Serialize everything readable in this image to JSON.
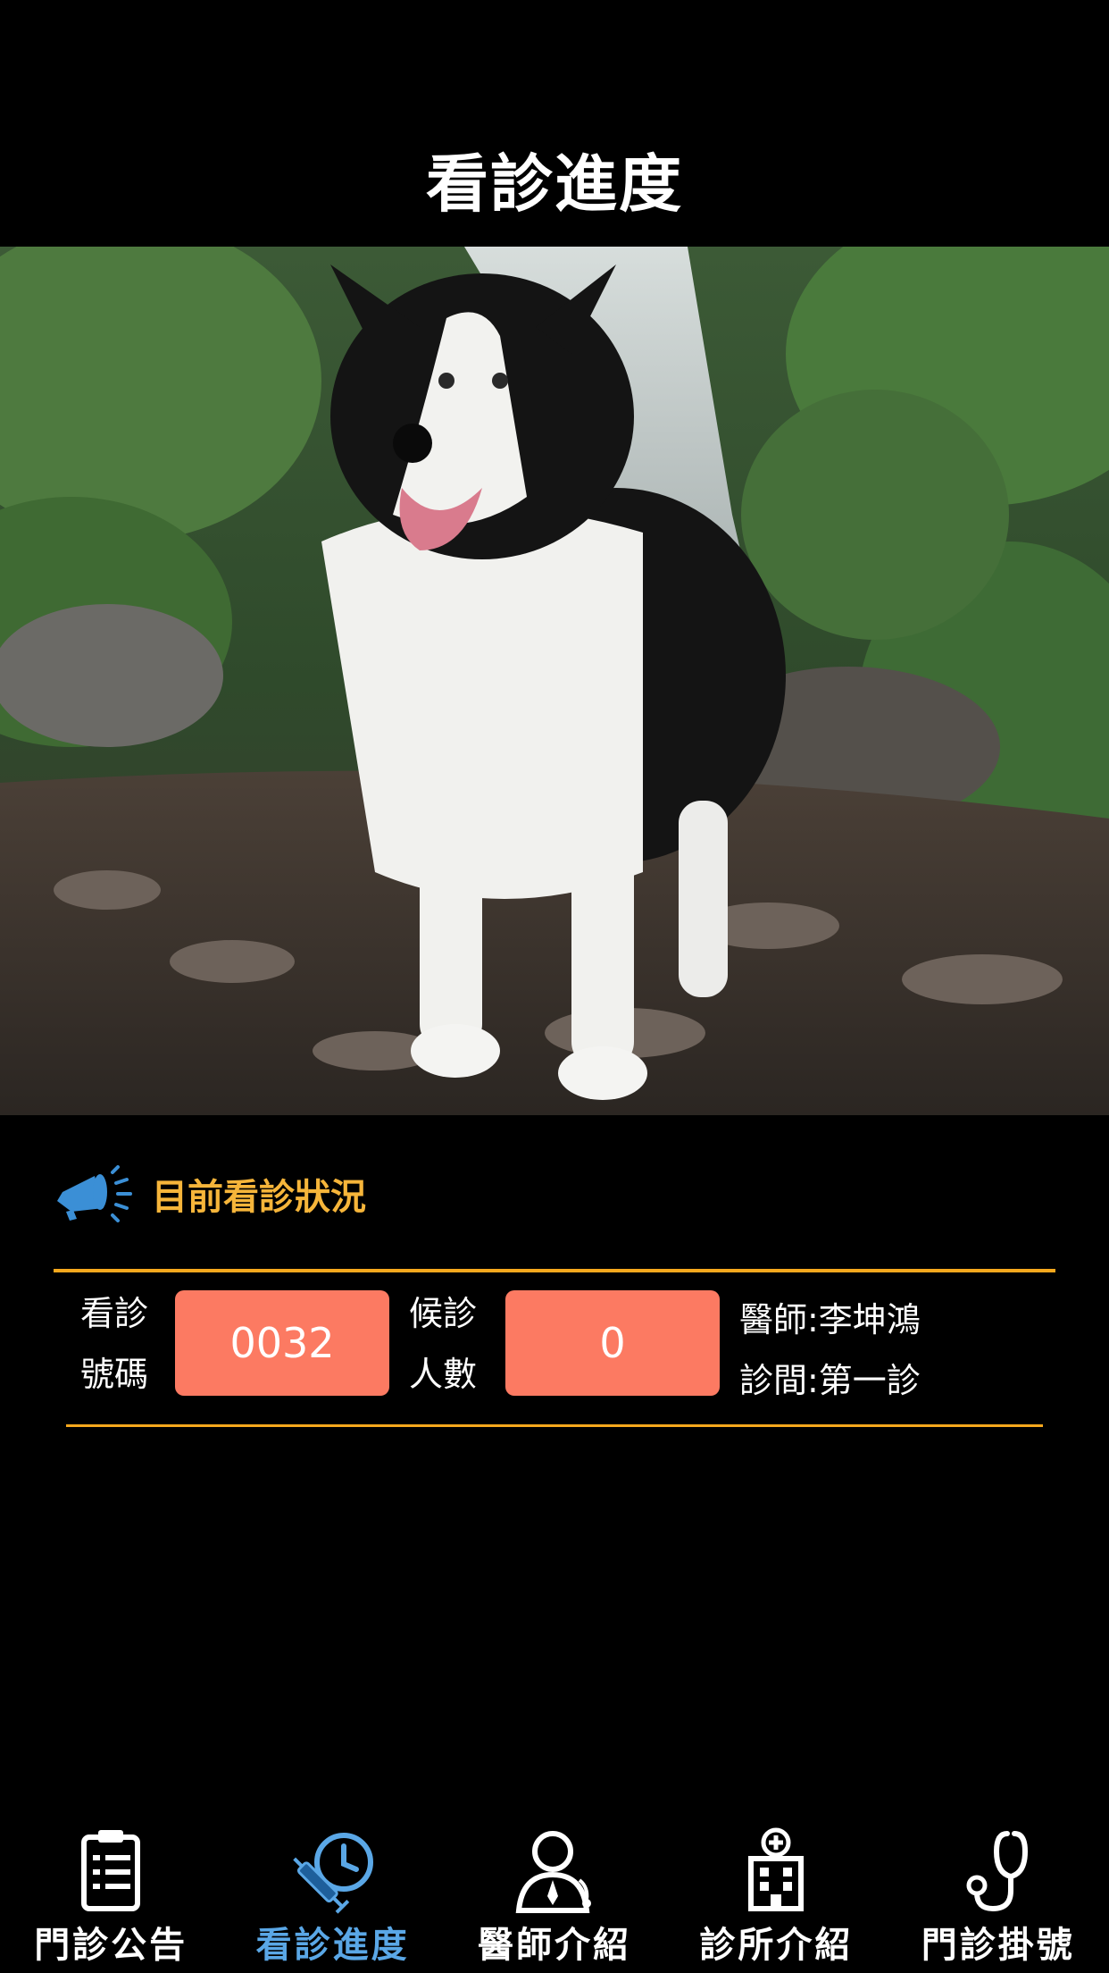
{
  "header": {
    "title": "看診進度"
  },
  "hero": {
    "image": "border-collie-waterfall-photo"
  },
  "status": {
    "title": "目前看診狀況",
    "icon": "megaphone-icon",
    "number_label_line1": "看診",
    "number_label_line2": "號碼",
    "current_number": "0032",
    "waiting_label_line1": "候診",
    "waiting_label_line2": "人數",
    "waiting_count": "0",
    "doctor": "醫師:李坤鴻",
    "room": "診間:第一診"
  },
  "tabs": [
    {
      "label": "門診公告",
      "icon": "clipboard-icon",
      "active": false
    },
    {
      "label": "看診進度",
      "icon": "syringe-clock-icon",
      "active": true
    },
    {
      "label": "醫師介紹",
      "icon": "doctor-icon",
      "active": false
    },
    {
      "label": "診所介紹",
      "icon": "hospital-icon",
      "active": false
    },
    {
      "label": "門診掛號",
      "icon": "stethoscope-icon",
      "active": false
    }
  ],
  "colors": {
    "accent_orange": "#f6a81d",
    "title_orange": "#f6b53a",
    "number_box": "#fc7a62",
    "tab_active": "#5aa7e6",
    "megaphone_blue": "#3b8fd6"
  }
}
